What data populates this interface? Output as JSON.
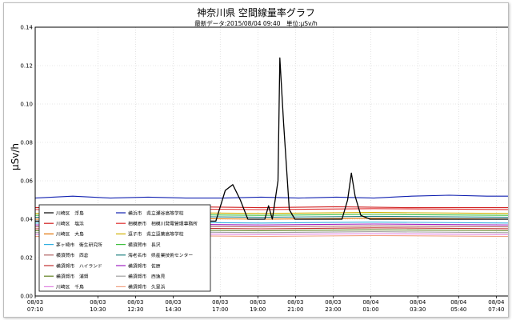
{
  "chart_data": {
    "type": "line",
    "title": "神奈川県 空間線量率グラフ",
    "subtitle": "最新データ:2015/08/04 09:40　単位:μSv/h",
    "ylabel": "μSv/h",
    "xlabel": "",
    "ylim": [
      0,
      0.14
    ],
    "yticks": [
      "0.00",
      "0.02",
      "0.04",
      "0.06",
      "0.08",
      "0.10",
      "0.12",
      "0.14"
    ],
    "xlim": [
      0,
      25.25
    ],
    "xticks": [
      {
        "date": "08/03",
        "time": "07:10",
        "x": 0
      },
      {
        "date": "08/03",
        "time": "10:30",
        "x": 3.33
      },
      {
        "date": "08/03",
        "time": "12:30",
        "x": 5.33
      },
      {
        "date": "08/03",
        "time": "14:30",
        "x": 7.33
      },
      {
        "date": "08/03",
        "time": "17:00",
        "x": 9.83
      },
      {
        "date": "08/03",
        "time": "19:00",
        "x": 11.83
      },
      {
        "date": "08/03",
        "time": "21:00",
        "x": 13.83
      },
      {
        "date": "08/03",
        "time": "23:00",
        "x": 15.83
      },
      {
        "date": "08/04",
        "time": "01:00",
        "x": 17.83
      },
      {
        "date": "08/04",
        "time": "03:30",
        "x": 20.33
      },
      {
        "date": "08/04",
        "time": "05:40",
        "x": 22.5
      },
      {
        "date": "08/04",
        "time": "07:40",
        "x": 24.5
      }
    ],
    "grid": true,
    "legend_position": "bottom-left",
    "series": [
      {
        "name": "川崎区　浮島",
        "color": "#000000",
        "points": [
          [
            0,
            0.039
          ],
          [
            9.6,
            0.039
          ],
          [
            10.1,
            0.055
          ],
          [
            10.5,
            0.058
          ],
          [
            10.9,
            0.05
          ],
          [
            11.3,
            0.04
          ],
          [
            12.2,
            0.04
          ],
          [
            12.4,
            0.047
          ],
          [
            12.6,
            0.04
          ],
          [
            12.9,
            0.06
          ],
          [
            13.0,
            0.124
          ],
          [
            13.2,
            0.09
          ],
          [
            13.5,
            0.045
          ],
          [
            13.8,
            0.04
          ],
          [
            16.3,
            0.04
          ],
          [
            16.6,
            0.05
          ],
          [
            16.8,
            0.064
          ],
          [
            17.0,
            0.052
          ],
          [
            17.3,
            0.042
          ],
          [
            17.8,
            0.04
          ],
          [
            25.25,
            0.04
          ]
        ]
      },
      {
        "name": "川崎区　塩浜",
        "color": "#d02020",
        "points": [
          [
            0,
            0.046
          ],
          [
            4,
            0.046
          ],
          [
            8,
            0.0465
          ],
          [
            12,
            0.046
          ],
          [
            16,
            0.0465
          ],
          [
            20,
            0.046
          ],
          [
            25.25,
            0.046
          ]
        ]
      },
      {
        "name": "川崎区　大島",
        "color": "#e07000",
        "points": [
          [
            0,
            0.04
          ],
          [
            6,
            0.0405
          ],
          [
            12,
            0.04
          ],
          [
            18,
            0.0405
          ],
          [
            25.25,
            0.04
          ]
        ]
      },
      {
        "name": "茅ヶ崎市　衛生研究所",
        "color": "#30b0e0",
        "points": [
          [
            0,
            0.038
          ],
          [
            6,
            0.0385
          ],
          [
            12,
            0.038
          ],
          [
            18,
            0.0385
          ],
          [
            25.25,
            0.038
          ]
        ]
      },
      {
        "name": "横須賀市　西倉",
        "color": "#b06060",
        "points": [
          [
            0,
            0.036
          ],
          [
            6,
            0.0365
          ],
          [
            12,
            0.036
          ],
          [
            18,
            0.0365
          ],
          [
            25.25,
            0.036
          ]
        ]
      },
      {
        "name": "横須賀市　ハイランド",
        "color": "#c03030",
        "points": [
          [
            0,
            0.035
          ],
          [
            6,
            0.0355
          ],
          [
            12,
            0.035
          ],
          [
            18,
            0.0355
          ],
          [
            25.25,
            0.035
          ]
        ]
      },
      {
        "name": "横須賀市　浦賀",
        "color": "#608020",
        "points": [
          [
            0,
            0.034
          ],
          [
            6,
            0.0345
          ],
          [
            12,
            0.034
          ],
          [
            18,
            0.0345
          ],
          [
            25.25,
            0.034
          ]
        ]
      },
      {
        "name": "川崎区　千鳥",
        "color": "#e080e0",
        "points": [
          [
            0,
            0.032
          ],
          [
            6,
            0.0325
          ],
          [
            12,
            0.032
          ],
          [
            18,
            0.0325
          ],
          [
            25.25,
            0.032
          ]
        ]
      },
      {
        "name": "横浜市　県立瀬谷高等学校",
        "color": "#1020b0",
        "points": [
          [
            0,
            0.051
          ],
          [
            2,
            0.052
          ],
          [
            4,
            0.051
          ],
          [
            6,
            0.0515
          ],
          [
            8,
            0.051
          ],
          [
            10,
            0.051
          ],
          [
            12,
            0.0515
          ],
          [
            14,
            0.051
          ],
          [
            16,
            0.0515
          ],
          [
            18,
            0.051
          ],
          [
            20,
            0.052
          ],
          [
            22,
            0.0525
          ],
          [
            24,
            0.052
          ],
          [
            25.25,
            0.052
          ]
        ]
      },
      {
        "name": "相模原市　相模川発電管理事務所",
        "color": "#e03030",
        "points": [
          [
            0,
            0.045
          ],
          [
            6,
            0.0455
          ],
          [
            12,
            0.045
          ],
          [
            18,
            0.0455
          ],
          [
            25.25,
            0.045
          ]
        ]
      },
      {
        "name": "逗子市　県立逗葉高等学校",
        "color": "#d0b000",
        "points": [
          [
            0,
            0.043
          ],
          [
            6,
            0.0435
          ],
          [
            12,
            0.043
          ],
          [
            18,
            0.0435
          ],
          [
            25.25,
            0.043
          ]
        ]
      },
      {
        "name": "横須賀市　長沢",
        "color": "#40c040",
        "points": [
          [
            0,
            0.042
          ],
          [
            6,
            0.0425
          ],
          [
            12,
            0.042
          ],
          [
            18,
            0.0425
          ],
          [
            25.25,
            0.042
          ]
        ]
      },
      {
        "name": "海老名市　県産業技術センター",
        "color": "#208080",
        "points": [
          [
            0,
            0.041
          ],
          [
            6,
            0.0415
          ],
          [
            12,
            0.041
          ],
          [
            18,
            0.0415
          ],
          [
            25.25,
            0.041
          ]
        ]
      },
      {
        "name": "横須賀市　佐原",
        "color": "#a020c0",
        "points": [
          [
            0,
            0.037
          ],
          [
            6,
            0.0375
          ],
          [
            12,
            0.037
          ],
          [
            18,
            0.0375
          ],
          [
            25.25,
            0.037
          ]
        ]
      },
      {
        "name": "横須賀市　西逸見",
        "color": "#a0a0a0",
        "points": [
          [
            0,
            0.033
          ],
          [
            6,
            0.0335
          ],
          [
            12,
            0.033
          ],
          [
            18,
            0.0335
          ],
          [
            25.25,
            0.033
          ]
        ]
      },
      {
        "name": "横須賀市　久里浜",
        "color": "#f0a080",
        "points": [
          [
            0,
            0.031
          ],
          [
            6,
            0.0315
          ],
          [
            12,
            0.031
          ],
          [
            18,
            0.0315
          ],
          [
            25.25,
            0.031
          ]
        ]
      }
    ]
  }
}
